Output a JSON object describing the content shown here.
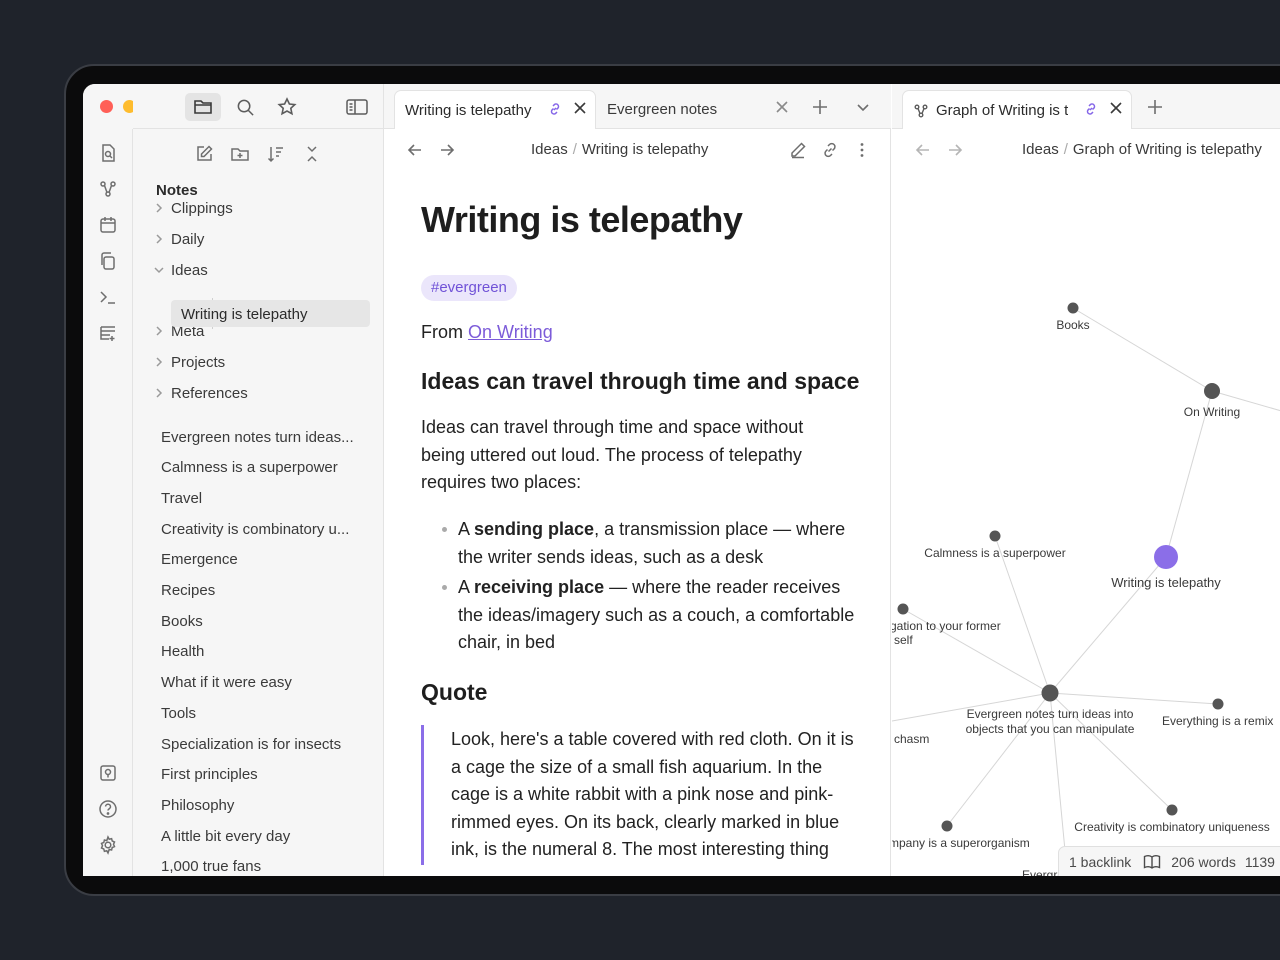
{
  "sidebar": {
    "tree_root": "Notes",
    "folders": [
      {
        "label": "Clippings",
        "expanded": false
      },
      {
        "label": "Daily",
        "expanded": false
      },
      {
        "label": "Ideas",
        "expanded": true
      },
      {
        "label": "Meta",
        "expanded": false
      },
      {
        "label": "Projects",
        "expanded": false
      },
      {
        "label": "References",
        "expanded": false
      }
    ],
    "active_file": "Writing is telepathy",
    "files": [
      "Evergreen notes turn ideas...",
      "Calmness is a superpower",
      "Travel",
      "Creativity is combinatory u...",
      "Emergence",
      "Recipes",
      "Books",
      "Health",
      "What if it were easy",
      "Tools",
      "Specialization is for insects",
      "First principles",
      "Philosophy",
      "A little bit every day",
      "1,000 true fans"
    ]
  },
  "tabs": {
    "editor": [
      {
        "label": "Writing is telepathy",
        "active": true
      },
      {
        "label": "Evergreen notes",
        "active": false
      }
    ],
    "graph": [
      {
        "label": "Graph of Writing is t",
        "active": true
      }
    ]
  },
  "editor": {
    "breadcrumb": {
      "folder": "Ideas",
      "file": "Writing is telepathy"
    },
    "title": "Writing is telepathy",
    "tag": "#evergreen",
    "from_prefix": "From",
    "from_link": "On Writing",
    "heading1": "Ideas can travel through time and space",
    "paragraph": "Ideas can travel through time and space without being uttered out loud. The process of telepathy requires two places:",
    "bullets": [
      {
        "pre": "A ",
        "bold": "sending place",
        "post": ", a transmission place — where the writer sends ideas, such as a desk"
      },
      {
        "pre": "A ",
        "bold": "receiving place",
        "post": " — where the reader receives the ideas/imagery such as a couch, a comfortable chair, in bed"
      }
    ],
    "heading2": "Quote",
    "quote": "Look, here's a table covered with red cloth. On it is a cage the size of a small fish aquarium. In the cage is a white rabbit with a pink nose and pink-rimmed eyes. On its back, clearly marked in blue ink, is the numeral 8. The most interesting thing"
  },
  "graph": {
    "breadcrumb": {
      "folder": "Ideas",
      "file": "Graph of Writing is telepathy"
    },
    "labels": {
      "books": "Books",
      "on_writing": "On Writing",
      "calmness": "Calmness is a superpower",
      "writing": "Writing is telepathy",
      "obligation1": "gation to your former",
      "obligation2": "self",
      "evergreen_turn1": "Evergreen notes turn ideas into",
      "evergreen_turn2": "objects that you can manipulate",
      "remix": "Everything is a remix",
      "chasm": "chasm",
      "creativity": "Creativity is combinatory uniqueness",
      "company": "mpany is a superorganism",
      "evergreen_notes": "Evergreen notes"
    },
    "accent_color": "#8b6ee8"
  },
  "status": {
    "backlinks": "1 backlink",
    "words": "206 words",
    "chars": "1139"
  }
}
